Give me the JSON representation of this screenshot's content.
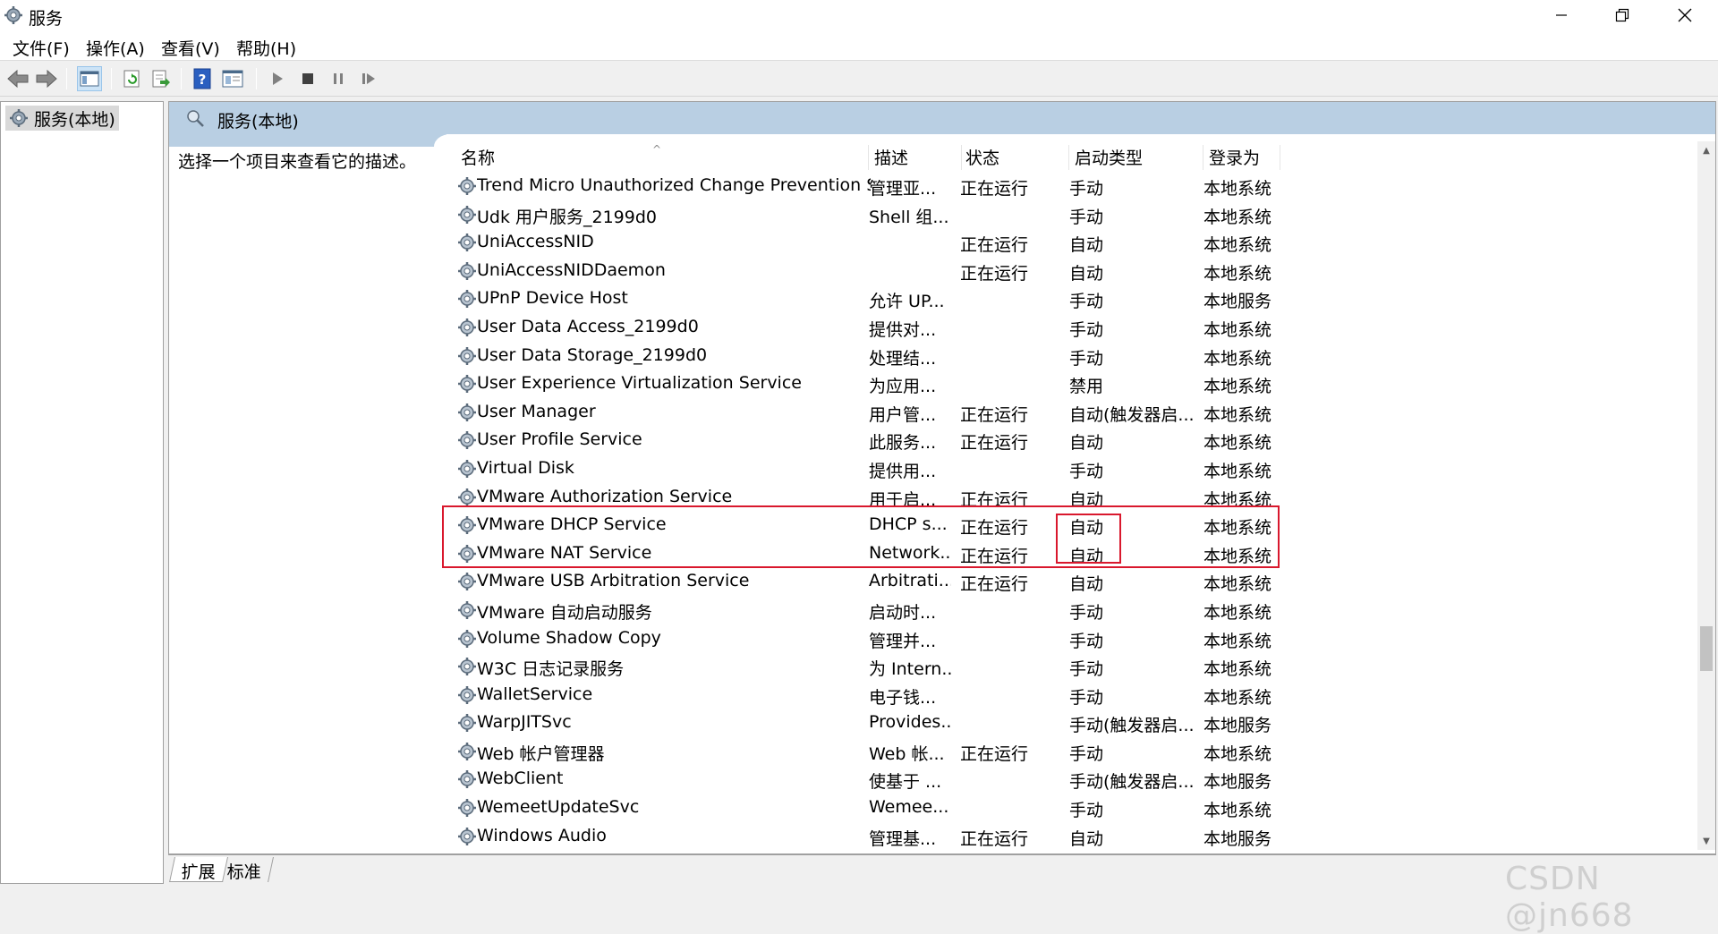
{
  "window": {
    "title": "服务"
  },
  "menu": [
    "文件(F)",
    "操作(A)",
    "查看(V)",
    "帮助(H)"
  ],
  "toolbar": [
    "back-icon",
    "forward-icon",
    "show-hide-console-tree-icon",
    "refresh-icon",
    "export-list-icon",
    "help-icon",
    "properties-icon",
    "start-service-icon",
    "stop-service-icon",
    "pause-service-icon",
    "resume-service-icon"
  ],
  "tree": {
    "root": "服务(本地)"
  },
  "pane": {
    "header": "服务(本地)",
    "description": "选择一个项目来查看它的描述。"
  },
  "columns": [
    "名称",
    "描述",
    "状态",
    "启动类型",
    "登录为"
  ],
  "services": [
    {
      "name": "Trend Micro Unauthorized Change Prevention Se...",
      "desc": "管理亚...",
      "status": "正在运行",
      "start": "手动",
      "logon": "本地系统"
    },
    {
      "name": "Udk 用户服务_2199d0",
      "desc": "Shell 组...",
      "status": "",
      "start": "手动",
      "logon": "本地系统"
    },
    {
      "name": "UniAccessNID",
      "desc": "",
      "status": "正在运行",
      "start": "自动",
      "logon": "本地系统"
    },
    {
      "name": "UniAccessNIDDaemon",
      "desc": "",
      "status": "正在运行",
      "start": "自动",
      "logon": "本地系统"
    },
    {
      "name": "UPnP Device Host",
      "desc": "允许 UP...",
      "status": "",
      "start": "手动",
      "logon": "本地服务"
    },
    {
      "name": "User Data Access_2199d0",
      "desc": "提供对...",
      "status": "",
      "start": "手动",
      "logon": "本地系统"
    },
    {
      "name": "User Data Storage_2199d0",
      "desc": "处理结...",
      "status": "",
      "start": "手动",
      "logon": "本地系统"
    },
    {
      "name": "User Experience Virtualization Service",
      "desc": "为应用...",
      "status": "",
      "start": "禁用",
      "logon": "本地系统"
    },
    {
      "name": "User Manager",
      "desc": "用户管...",
      "status": "正在运行",
      "start": "自动(触发器启...",
      "logon": "本地系统"
    },
    {
      "name": "User Profile Service",
      "desc": "此服务...",
      "status": "正在运行",
      "start": "自动",
      "logon": "本地系统"
    },
    {
      "name": "Virtual Disk",
      "desc": "提供用...",
      "status": "",
      "start": "手动",
      "logon": "本地系统"
    },
    {
      "name": "VMware Authorization Service",
      "desc": "用于启...",
      "status": "正在运行",
      "start": "自动",
      "logon": "本地系统"
    },
    {
      "name": "VMware DHCP Service",
      "desc": "DHCP s...",
      "status": "正在运行",
      "start": "自动",
      "logon": "本地系统"
    },
    {
      "name": "VMware NAT Service",
      "desc": "Network...",
      "status": "正在运行",
      "start": "自动",
      "logon": "本地系统"
    },
    {
      "name": "VMware USB Arbitration Service",
      "desc": "Arbitrati...",
      "status": "正在运行",
      "start": "自动",
      "logon": "本地系统"
    },
    {
      "name": "VMware 自动启动服务",
      "desc": "启动时...",
      "status": "",
      "start": "手动",
      "logon": "本地系统"
    },
    {
      "name": "Volume Shadow Copy",
      "desc": "管理并...",
      "status": "",
      "start": "手动",
      "logon": "本地系统"
    },
    {
      "name": "W3C 日志记录服务",
      "desc": "为 Intern...",
      "status": "",
      "start": "手动",
      "logon": "本地系统"
    },
    {
      "name": "WalletService",
      "desc": "电子钱...",
      "status": "",
      "start": "手动",
      "logon": "本地系统"
    },
    {
      "name": "WarpJITSvc",
      "desc": "Provides...",
      "status": "",
      "start": "手动(触发器启...",
      "logon": "本地服务"
    },
    {
      "name": "Web 帐户管理器",
      "desc": "Web 帐...",
      "status": "正在运行",
      "start": "手动",
      "logon": "本地系统"
    },
    {
      "name": "WebClient",
      "desc": "使基于 ...",
      "status": "",
      "start": "手动(触发器启...",
      "logon": "本地服务"
    },
    {
      "name": "WemeetUpdateSvc",
      "desc": "Wemee...",
      "status": "",
      "start": "手动",
      "logon": "本地系统"
    },
    {
      "name": "Windows Audio",
      "desc": "管理基...",
      "status": "正在运行",
      "start": "自动",
      "logon": "本地服务"
    }
  ],
  "tabs": [
    "扩展",
    "标准"
  ],
  "watermark": "CSDN @jn668",
  "colors": {
    "header_bg": "#b9cfe3",
    "highlight": "#d9182d",
    "tree_selected": "#d9d9d9"
  }
}
